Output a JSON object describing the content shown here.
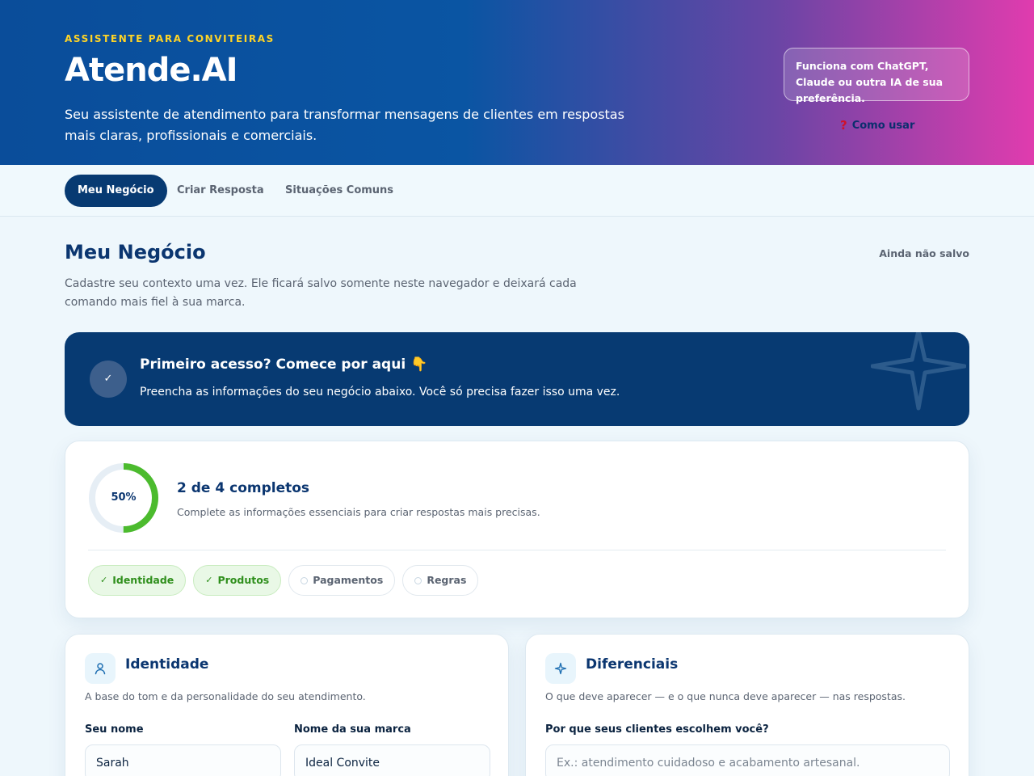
{
  "header": {
    "eyebrow": "ASSISTENTE PARA CONVITEIRAS",
    "brand": "Atende.AI",
    "tagline": "Seu assistente de atendimento para transformar mensagens de clientes em respostas mais claras, profissionais e comerciais.",
    "compat_note": "Funciona com ChatGPT, Claude ou outra IA de sua preferência.",
    "howto_label": "Como usar",
    "howto_icon": "question-icon"
  },
  "tabs": [
    {
      "label": "Meu Negócio",
      "active": true
    },
    {
      "label": "Criar Resposta",
      "active": false
    },
    {
      "label": "Situações Comuns",
      "active": false
    }
  ],
  "section": {
    "title": "Meu Negócio",
    "description": "Cadastre seu contexto uma vez. Ele ficará salvo somente neste navegador e deixará cada comando mais fiel à sua marca.",
    "save_status": "Ainda não salvo"
  },
  "banner": {
    "title": "Primeiro acesso? Comece por aqui 👇",
    "text": "Preencha as informações do seu negócio abaixo. Você só precisa fazer isso uma vez.",
    "check_glyph": "✓"
  },
  "progress": {
    "percent_label": "50%",
    "percent": 50,
    "title": "2 de 4 completos",
    "description": "Complete as informações essenciais para criar respostas mais precisas.",
    "steps": [
      {
        "label": "Identidade",
        "done": true
      },
      {
        "label": "Produtos",
        "done": true
      },
      {
        "label": "Pagamentos",
        "done": false
      },
      {
        "label": "Regras",
        "done": false
      }
    ],
    "done_glyph": "✓"
  },
  "identity": {
    "title": "Identidade",
    "description": "A base do tom e da personalidade do seu atendimento.",
    "name_label": "Seu nome",
    "name_value": "Sarah",
    "brand_label": "Nome da sua marca",
    "brand_value": "Ideal Convite"
  },
  "differentials": {
    "title": "Diferenciais",
    "description": "O que deve aparecer — e o que nunca deve aparecer — nas respostas.",
    "why_label": "Por que seus clientes escolhem você?",
    "why_placeholder": "Ex.: atendimento cuidadoso e acabamento artesanal."
  },
  "colors": {
    "primary": "#073a72",
    "accent_yellow": "#ffd426",
    "success": "#4cbb2e",
    "gradient_end": "#e03cae"
  }
}
